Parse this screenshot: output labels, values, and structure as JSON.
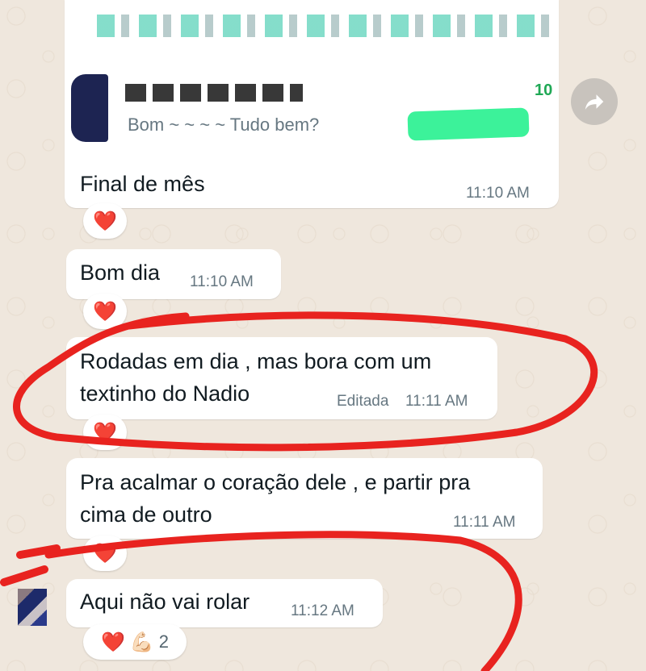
{
  "top_card": {
    "sender_label": "",
    "time_fragment": "10",
    "quote_text": "Bom ~ ~ ~ ~ Tudo bem?"
  },
  "messages": [
    {
      "text": "Final de mês",
      "time": "11:10 AM",
      "edited": "",
      "reactions": [
        "❤️"
      ],
      "reaction_count": ""
    },
    {
      "text": "Bom dia",
      "time": "11:10 AM",
      "edited": "",
      "reactions": [
        "❤️"
      ],
      "reaction_count": ""
    },
    {
      "text": "Rodadas em dia , mas bora com um\ntextinho do Nadio",
      "time": "11:11 AM",
      "edited": "Editada",
      "reactions": [
        "❤️"
      ],
      "reaction_count": ""
    },
    {
      "text": "Pra acalmar o coração dele , e partir pra\ncima de outro",
      "time": "11:11 AM",
      "edited": "",
      "reactions": [
        "❤️"
      ],
      "reaction_count": ""
    },
    {
      "text": "Aqui não vai rolar",
      "time": "11:12 AM",
      "edited": "",
      "reactions": [
        "❤️",
        "💪🏻"
      ],
      "reaction_count": "2"
    }
  ],
  "colors": {
    "background": "#efe7dd",
    "bubble": "#ffffff",
    "timestamp": "#667781",
    "annotation_red": "#e8231f",
    "highlight_green": "#3cf29a"
  },
  "icons": [
    "forward-icon",
    "heart-icon",
    "flexed-biceps-icon",
    "avatar"
  ]
}
